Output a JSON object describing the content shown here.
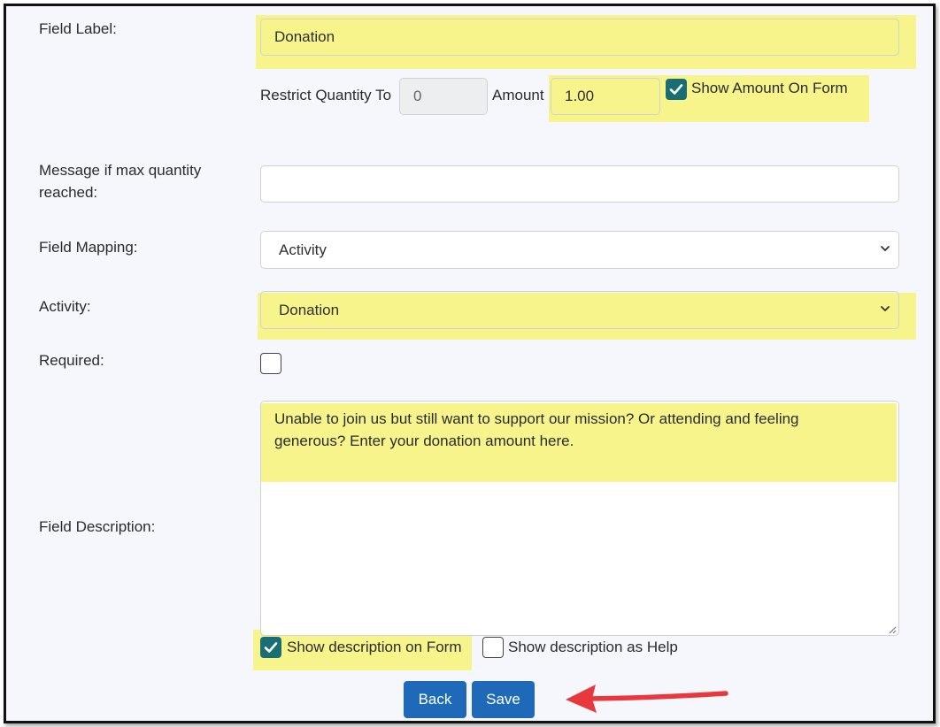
{
  "form": {
    "field_label": {
      "label": "Field Label:",
      "value": "Donation"
    },
    "restrict_quantity": {
      "label": "Restrict Quantity To",
      "value": "0"
    },
    "amount": {
      "label": "Amount",
      "value": "1.00"
    },
    "show_amount": {
      "label": "Show Amount On Form",
      "checked": true
    },
    "max_message": {
      "label_line1": "Message if max quantity",
      "label_line2": "reached:",
      "value": ""
    },
    "field_mapping": {
      "label": "Field Mapping:",
      "selected": "Activity"
    },
    "activity": {
      "label": "Activity:",
      "selected": "Donation"
    },
    "required": {
      "label": "Required:",
      "checked": false
    },
    "field_description": {
      "label": "Field Description:",
      "line1": "Unable to join us but still want to support our mission? Or attending and feeling",
      "line2": "generous? Enter your donation amount here."
    },
    "show_desc_form": {
      "label": "Show description on Form",
      "checked": true
    },
    "show_desc_help": {
      "label": "Show description as Help",
      "checked": false
    }
  },
  "buttons": {
    "back": "Back",
    "save": "Save"
  },
  "colors": {
    "highlight": "#f7f48c",
    "button": "#1f6ab8",
    "checkbox": "#1a6d73",
    "arrow": "#e8383d"
  },
  "icons": {
    "check": "check-icon",
    "select_arrow": "chevron-down-icon",
    "annotation": "arrow-left-icon"
  }
}
